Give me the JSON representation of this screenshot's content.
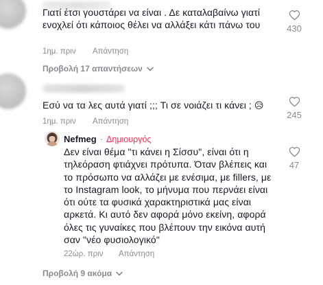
{
  "comments": [
    {
      "text": "Γιατί έτσι γουστάρει να είναι . Δε καταλαβαίνω γιατί\nενοχλεί ότι κάποιος θέλει να αλλάξει κάτι πάνω του",
      "time": "1ημ. πριν",
      "reply_label": "Απάντηση",
      "likes": "430",
      "view_replies": "Προβολή 17 απαντήσεων"
    },
    {
      "text": "Εσύ να τα λες αυτά γιατί ;;; Τι σε νοιάζει τι κάνει ;",
      "emoji": "😥",
      "time": "1ημ. πριν",
      "reply_label": "Απάντηση",
      "likes": "245"
    }
  ],
  "creator_reply": {
    "author": "Nefmeg",
    "separator": "·",
    "badge": "Δημιουργός",
    "text": "Δεν είναι θέμα \"τι κάνει η Σίσσυ\", είναι ότι η\nτηλεόραση φτιάχνει πρότυπα. Όταν βλέπεις και\nτο πρόσωπο να αλλάζει με ενέσιμα, με fillers, με\nτο Instagram look, το μήνυμα που περνάει είναι\nότι ούτε τα φυσικά χαρακτηριστικά μας είναι\nαρκετά. Κι αυτό δεν αφορά μόνο εκείνη, αφορά\nόλες τις γυναίκες που βλέπουν την εικόνα αυτή\nσαν \"νέο φυσιολογικό\"",
    "time": "22ώρ. πριν",
    "reply_label": "Απάντηση",
    "likes": "47"
  },
  "view_more": "Προβολή 9 ακόμα",
  "colors": {
    "text": "#161823",
    "muted": "#8a8b91",
    "creator_badge": "#fe2c55"
  },
  "icons": [
    "heart-icon",
    "chevron-down-icon",
    "avatar"
  ]
}
